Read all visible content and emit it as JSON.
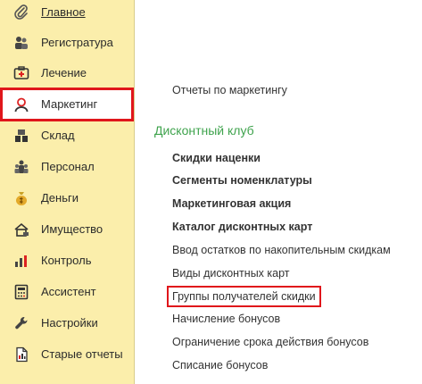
{
  "sidebar": {
    "items": [
      {
        "label": "Главное",
        "icon": "paperclip-icon"
      },
      {
        "label": "Регистратура",
        "icon": "registry-people-icon"
      },
      {
        "label": "Лечение",
        "icon": "medical-kit-icon"
      },
      {
        "label": "Маркетинг",
        "icon": "marketing-person-icon"
      },
      {
        "label": "Склад",
        "icon": "warehouse-icon"
      },
      {
        "label": "Персонал",
        "icon": "staff-icon"
      },
      {
        "label": "Деньги",
        "icon": "money-bag-icon"
      },
      {
        "label": "Имущество",
        "icon": "property-icon"
      },
      {
        "label": "Контроль",
        "icon": "control-chart-icon"
      },
      {
        "label": "Ассистент",
        "icon": "assistant-calculator-icon"
      },
      {
        "label": "Настройки",
        "icon": "wrench-icon"
      },
      {
        "label": "Старые отчеты",
        "icon": "old-reports-icon"
      }
    ],
    "active_item": "Маркетинг"
  },
  "content": {
    "reports_link": "Отчеты по маркетингу",
    "section_title": "Дисконтный клуб",
    "links": [
      {
        "label": "Скидки наценки",
        "bold": true
      },
      {
        "label": "Сегменты номенклатуры",
        "bold": true
      },
      {
        "label": "Маркетинговая акция",
        "bold": true
      },
      {
        "label": "Каталог дисконтных карт",
        "bold": true
      },
      {
        "label": "Ввод остатков по накопительным скидкам",
        "bold": false
      },
      {
        "label": "Виды дисконтных карт",
        "bold": false
      },
      {
        "label": "Группы получателей скидки",
        "bold": false
      },
      {
        "label": "Начисление бонусов",
        "bold": false
      },
      {
        "label": "Ограничение срока действия бонусов",
        "bold": false
      },
      {
        "label": "Списание бонусов",
        "bold": false
      }
    ],
    "highlighted_link": "Группы получателей скидки"
  },
  "colors": {
    "sidebar_bg": "#fbeeab",
    "highlight_red": "#e0161b",
    "section_green": "#3fa34d"
  }
}
